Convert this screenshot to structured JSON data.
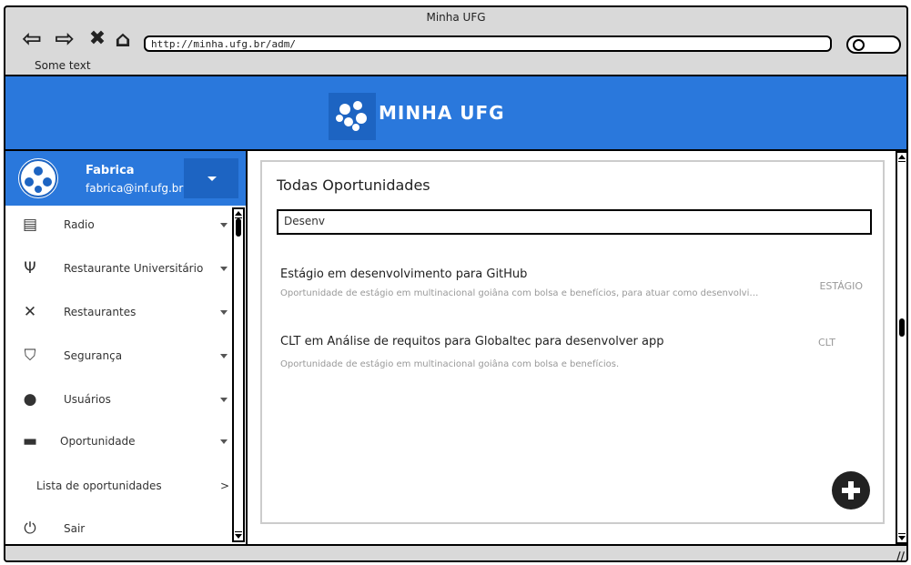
{
  "window": {
    "title": "Minha UFG",
    "url": "http://minha.ufg.br/adm/",
    "note": "Some text"
  },
  "header": {
    "brand": "MINHA UFG"
  },
  "profile": {
    "name": "Fabrica",
    "email": "fabrica@inf.ufg.br"
  },
  "menu": [
    {
      "label": "Radio",
      "icon": "radio-icon"
    },
    {
      "label": "Restaurante Universitário",
      "icon": "fork-knife-icon"
    },
    {
      "label": "Restaurantes",
      "icon": "utensils-icon"
    },
    {
      "label": "Segurança",
      "icon": "shield-icon"
    },
    {
      "label": "Usuários",
      "icon": "user-icon"
    },
    {
      "label": "Oportunidade",
      "icon": "briefcase-icon"
    }
  ],
  "submenu": {
    "label": "Lista de oportunidades",
    "arrow": ">"
  },
  "logout": {
    "label": "Sair",
    "icon": "power-icon"
  },
  "content": {
    "title": "Todas Oportunidades",
    "search_value": "Desenv",
    "items": [
      {
        "title": "Estágio em desenvolvimento para GitHub",
        "desc": "Oportunidade de estágio em multinacional goiâna com bolsa e benefícios, para atuar como desenvolvi…",
        "tag": "ESTÁGIO"
      },
      {
        "title": "CLT em Análise de requitos para Globaltec para desenvolver app",
        "desc": "Oportunidade de estágio em multinacional goiâna com bolsa e benefícios.",
        "tag": "CLT"
      }
    ]
  },
  "colors": {
    "primary": "#2a78dc",
    "primary_dark": "#1d64c2"
  }
}
